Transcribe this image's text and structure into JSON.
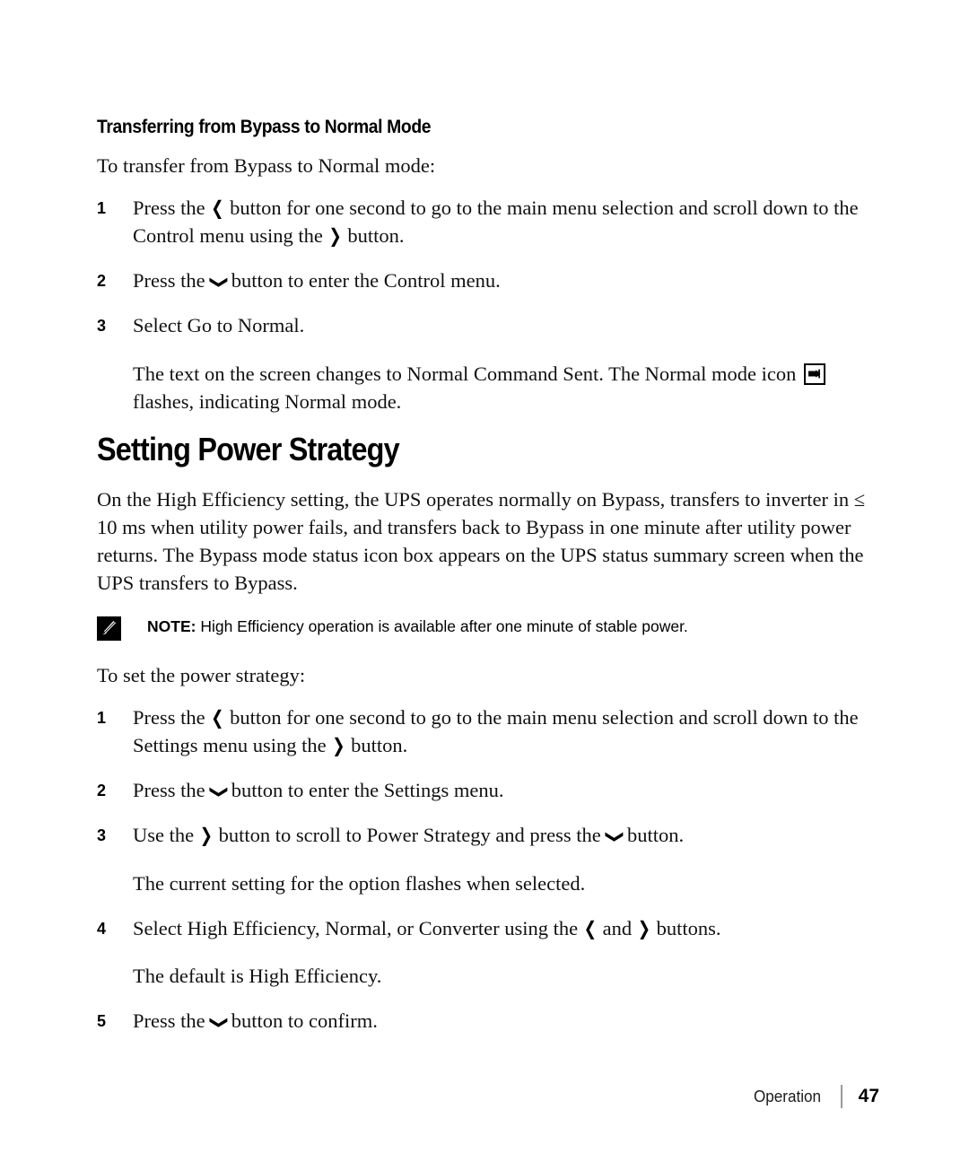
{
  "document": {
    "section_heading": "Transferring from Bypass to Normal Mode",
    "chapter_heading": "Setting Power Strategy"
  },
  "glyphs": {
    "left_button": "❮",
    "right_button": "❯",
    "down_button": "❮"
  },
  "bypass_to_normal": {
    "intro": "To transfer from Bypass to Normal mode:",
    "steps": [
      {
        "number": "1",
        "text_before": "Press the",
        "glyph": "left-button",
        "text_after": "button for one second to go to the main menu selection and scroll down to the Control menu using the",
        "glyph2": "right-button",
        "text_end": "button."
      },
      {
        "number": "2",
        "text_before": "Press the",
        "glyph": "down-button",
        "text_after": "button to enter the Control menu."
      },
      {
        "number": "3",
        "text_before": "Select Go to Normal."
      }
    ],
    "result_before": "The text on the screen changes to Normal Command Sent. The Normal mode icon",
    "result_after": "flashes, indicating Normal mode."
  },
  "power_strategy": {
    "description": "On the High Efficiency setting, the UPS operates normally on Bypass, transfers to inverter in ≤ 10 ms when utility power fails, and transfers back to Bypass in one minute after utility power returns. The Bypass mode status icon box appears on the UPS status summary screen when the UPS transfers to Bypass.",
    "note_label": "NOTE:",
    "note_text": "High Efficiency operation is available after one minute of stable power.",
    "intro": "To set the power strategy:",
    "steps": [
      {
        "number": "1",
        "text_before": "Press the",
        "glyph": "left-button",
        "text_after": "button for one second to go to the main menu selection and scroll down to the Settings menu using the",
        "glyph2": "right-button",
        "text_end": "button."
      },
      {
        "number": "2",
        "text_before": "Press the",
        "glyph": "down-button",
        "text_after": "button to enter the Settings menu."
      },
      {
        "number": "3",
        "text_before": "Use the",
        "glyph": "right-button",
        "text_after": "button to scroll to Power Strategy and press the",
        "glyph2": "down-button",
        "text_end": "button."
      },
      {
        "number": "4",
        "text_before": "Select High Efficiency, Normal, or Converter using the",
        "glyph": "left-button",
        "text_after": "and",
        "glyph2": "right-button",
        "text_end": "buttons."
      },
      {
        "number": "5",
        "text_before": "Press the",
        "glyph": "down-button",
        "text_after": "button to confirm."
      }
    ],
    "substep_after_3": "The current setting for the option flashes when selected.",
    "substep_after_4": "The default is High Efficiency."
  },
  "footer": {
    "section": "Operation",
    "page_number": "47"
  }
}
